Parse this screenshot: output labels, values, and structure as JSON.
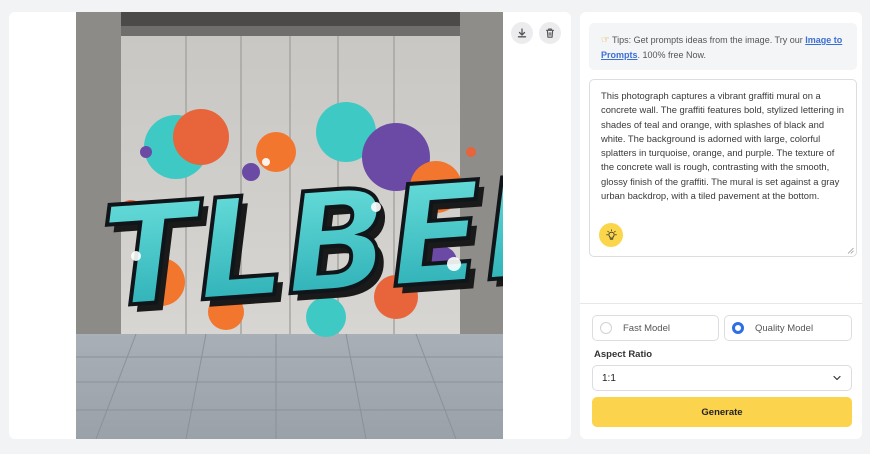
{
  "image_panel": {
    "photo_subject": "graffiti-mural-photo",
    "graffiti_text": "TLBER",
    "download_icon": "download-icon",
    "delete_icon": "trash-icon"
  },
  "tips": {
    "emoji_icon": "pointing-hand-icon",
    "text_before": "Tips: Get prompts ideas from the image. Try our ",
    "link_text": "Image to Prompts",
    "text_after": ". 100% free Now."
  },
  "prompt": {
    "text": "This photograph captures a vibrant graffiti mural on a concrete wall. The graffiti features bold, stylized lettering in shades of teal and orange, with splashes of black and white. The background is adorned with large, colorful splatters in turquoise, orange, and purple. The texture of the concrete wall is rough, contrasting with the smooth, glossy finish of the graffiti. The mural is set against a gray urban backdrop, with a tiled pavement at the bottom.",
    "action_icon": "lightbulb-icon"
  },
  "models": {
    "fast_label": "Fast Model",
    "quality_label": "Quality Model",
    "selected": "quality"
  },
  "aspect": {
    "label": "Aspect Ratio",
    "value": "1:1"
  },
  "generate_label": "Generate",
  "colors": {
    "accent_yellow": "#fcd34d",
    "link_blue": "#3b6fd4",
    "radio_blue": "#2f6fe4",
    "teal": "#3fc9c4",
    "orange": "#f2762e",
    "purple": "#6a4aa5"
  }
}
